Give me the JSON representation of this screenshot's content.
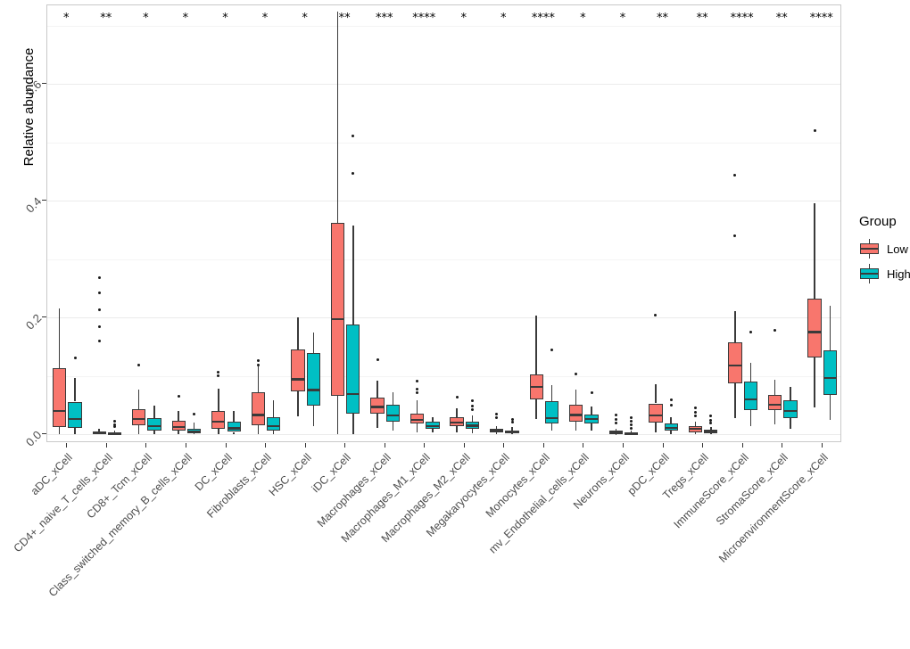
{
  "chart_data": {
    "type": "box",
    "title": "",
    "xlabel": "",
    "ylabel": "Relative abundance",
    "ylim": [
      -0.015,
      0.735
    ],
    "yticks": [
      0.0,
      0.2,
      0.4,
      0.6
    ],
    "ytick_labels": [
      "0.0",
      "0.2",
      "0.4",
      "0.6"
    ],
    "grid": true,
    "legend": {
      "title": "Group",
      "position": "right",
      "entries": [
        {
          "label": "Low",
          "color": "#F8766D"
        },
        {
          "label": "High",
          "color": "#00BFC4"
        }
      ]
    },
    "categories": [
      "aDC_xCell",
      "CD4+_naive_T_cells_xCell",
      "CD8+_Tcm_xCell",
      "Class_switched_memory_B_cells_xCell",
      "DC_xCell",
      "Fibroblasts_xCell",
      "HSC_xCell",
      "iDC_xCell",
      "Macrophages_xCell",
      "Macrophages_M1_xCell",
      "Macrophages_M2_xCell",
      "Megakaryocytes_xCell",
      "Monocytes_xCell",
      "mv_Endothelial_cells_xCell",
      "Neurons_xCell",
      "pDC_xCell",
      "Tregs_xCell",
      "ImmuneScore_xCell",
      "StromaScore_xCell",
      "MicroenvironmentScore_xCell"
    ],
    "significance": [
      "*",
      "**",
      "*",
      "*",
      "*",
      "*",
      "*",
      "**",
      "***",
      "****",
      "*",
      "*",
      "****",
      "*",
      "*",
      "**",
      "**",
      "****",
      "**",
      "****"
    ],
    "series": [
      {
        "name": "Low",
        "color": "#F8766D",
        "boxes": [
          {
            "lower_whisker": 0.0,
            "q1": 0.012,
            "median": 0.04,
            "q3": 0.113,
            "upper_whisker": 0.215,
            "outliers": []
          },
          {
            "lower_whisker": 0.0,
            "q1": 0.0,
            "median": 0.002,
            "q3": 0.005,
            "upper_whisker": 0.01,
            "outliers": [
              0.268,
              0.243,
              0.213,
              0.185,
              0.16
            ]
          },
          {
            "lower_whisker": 0.0,
            "q1": 0.016,
            "median": 0.026,
            "q3": 0.043,
            "upper_whisker": 0.076,
            "outliers": [
              0.118
            ]
          },
          {
            "lower_whisker": 0.0,
            "q1": 0.007,
            "median": 0.013,
            "q3": 0.023,
            "upper_whisker": 0.04,
            "outliers": [
              0.065
            ]
          },
          {
            "lower_whisker": 0.0,
            "q1": 0.01,
            "median": 0.022,
            "q3": 0.04,
            "upper_whisker": 0.078,
            "outliers": [
              0.106,
              0.1
            ]
          },
          {
            "lower_whisker": 0.0,
            "q1": 0.016,
            "median": 0.033,
            "q3": 0.072,
            "upper_whisker": 0.117,
            "outliers": [
              0.126,
              0.118
            ]
          },
          {
            "lower_whisker": 0.03,
            "q1": 0.074,
            "median": 0.094,
            "q3": 0.146,
            "upper_whisker": 0.2,
            "outliers": []
          },
          {
            "lower_whisker": 0.0,
            "q1": 0.066,
            "median": 0.197,
            "q3": 0.362,
            "upper_whisker": 0.725,
            "outliers": []
          },
          {
            "lower_whisker": 0.011,
            "q1": 0.035,
            "median": 0.047,
            "q3": 0.063,
            "upper_whisker": 0.092,
            "outliers": [
              0.128
            ]
          },
          {
            "lower_whisker": 0.004,
            "q1": 0.018,
            "median": 0.025,
            "q3": 0.036,
            "upper_whisker": 0.059,
            "outliers": [
              0.091,
              0.078,
              0.071
            ]
          },
          {
            "lower_whisker": 0.003,
            "q1": 0.014,
            "median": 0.02,
            "q3": 0.029,
            "upper_whisker": 0.044,
            "outliers": [
              0.063
            ]
          },
          {
            "lower_whisker": 0.0,
            "q1": 0.003,
            "median": 0.006,
            "q3": 0.009,
            "upper_whisker": 0.014,
            "outliers": [
              0.034,
              0.028
            ]
          },
          {
            "lower_whisker": 0.026,
            "q1": 0.06,
            "median": 0.081,
            "q3": 0.102,
            "upper_whisker": 0.203,
            "outliers": []
          },
          {
            "lower_whisker": 0.007,
            "q1": 0.022,
            "median": 0.033,
            "q3": 0.051,
            "upper_whisker": 0.077,
            "outliers": [
              0.104
            ]
          },
          {
            "lower_whisker": 0.0,
            "q1": 0.001,
            "median": 0.003,
            "q3": 0.006,
            "upper_whisker": 0.01,
            "outliers": [
              0.033,
              0.026,
              0.02
            ]
          },
          {
            "lower_whisker": 0.004,
            "q1": 0.02,
            "median": 0.032,
            "q3": 0.053,
            "upper_whisker": 0.086,
            "outliers": [
              0.205
            ]
          },
          {
            "lower_whisker": 0.0,
            "q1": 0.004,
            "median": 0.009,
            "q3": 0.014,
            "upper_whisker": 0.021,
            "outliers": [
              0.046,
              0.038,
              0.032
            ]
          },
          {
            "lower_whisker": 0.027,
            "q1": 0.088,
            "median": 0.118,
            "q3": 0.157,
            "upper_whisker": 0.211,
            "outliers": [
              0.444,
              0.34
            ]
          },
          {
            "lower_whisker": 0.017,
            "q1": 0.041,
            "median": 0.051,
            "q3": 0.067,
            "upper_whisker": 0.094,
            "outliers": [
              0.179
            ]
          },
          {
            "lower_whisker": 0.046,
            "q1": 0.132,
            "median": 0.175,
            "q3": 0.233,
            "upper_whisker": 0.396,
            "outliers": [
              0.521
            ]
          }
        ]
      },
      {
        "name": "High",
        "color": "#00BFC4",
        "boxes": [
          {
            "lower_whisker": 0.0,
            "q1": 0.011,
            "median": 0.026,
            "q3": 0.056,
            "upper_whisker": 0.097,
            "outliers": [
              0.131
            ]
          },
          {
            "lower_whisker": 0.0,
            "q1": 0.0,
            "median": 0.001,
            "q3": 0.003,
            "upper_whisker": 0.006,
            "outliers": [
              0.022,
              0.017,
              0.013
            ]
          },
          {
            "lower_whisker": 0.0,
            "q1": 0.006,
            "median": 0.014,
            "q3": 0.028,
            "upper_whisker": 0.049,
            "outliers": []
          },
          {
            "lower_whisker": 0.0,
            "q1": 0.002,
            "median": 0.005,
            "q3": 0.01,
            "upper_whisker": 0.02,
            "outliers": [
              0.034
            ]
          },
          {
            "lower_whisker": 0.0,
            "q1": 0.004,
            "median": 0.01,
            "q3": 0.021,
            "upper_whisker": 0.04,
            "outliers": []
          },
          {
            "lower_whisker": 0.0,
            "q1": 0.006,
            "median": 0.014,
            "q3": 0.03,
            "upper_whisker": 0.059,
            "outliers": []
          },
          {
            "lower_whisker": 0.014,
            "q1": 0.049,
            "median": 0.076,
            "q3": 0.14,
            "upper_whisker": 0.174,
            "outliers": []
          },
          {
            "lower_whisker": 0.0,
            "q1": 0.035,
            "median": 0.069,
            "q3": 0.188,
            "upper_whisker": 0.358,
            "outliers": [
              0.512,
              0.447
            ]
          },
          {
            "lower_whisker": 0.007,
            "q1": 0.021,
            "median": 0.032,
            "q3": 0.051,
            "upper_whisker": 0.072,
            "outliers": []
          },
          {
            "lower_whisker": 0.003,
            "q1": 0.01,
            "median": 0.014,
            "q3": 0.021,
            "upper_whisker": 0.029,
            "outliers": []
          },
          {
            "lower_whisker": 0.002,
            "q1": 0.01,
            "median": 0.015,
            "q3": 0.022,
            "upper_whisker": 0.032,
            "outliers": [
              0.058,
              0.049,
              0.043
            ]
          },
          {
            "lower_whisker": 0.0,
            "q1": 0.002,
            "median": 0.004,
            "q3": 0.007,
            "upper_whisker": 0.012,
            "outliers": [
              0.026,
              0.021
            ]
          },
          {
            "lower_whisker": 0.007,
            "q1": 0.018,
            "median": 0.028,
            "q3": 0.057,
            "upper_whisker": 0.085,
            "outliers": [
              0.144
            ]
          },
          {
            "lower_whisker": 0.006,
            "q1": 0.019,
            "median": 0.026,
            "q3": 0.034,
            "upper_whisker": 0.048,
            "outliers": [
              0.072
            ]
          },
          {
            "lower_whisker": 0.0,
            "q1": 0.0,
            "median": 0.001,
            "q3": 0.003,
            "upper_whisker": 0.007,
            "outliers": [
              0.029,
              0.022,
              0.016,
              0.011
            ]
          },
          {
            "lower_whisker": 0.0,
            "q1": 0.006,
            "median": 0.011,
            "q3": 0.019,
            "upper_whisker": 0.029,
            "outliers": [
              0.059,
              0.05
            ]
          },
          {
            "lower_whisker": 0.0,
            "q1": 0.002,
            "median": 0.004,
            "q3": 0.008,
            "upper_whisker": 0.013,
            "outliers": [
              0.031,
              0.024,
              0.019
            ]
          },
          {
            "lower_whisker": 0.014,
            "q1": 0.042,
            "median": 0.06,
            "q3": 0.091,
            "upper_whisker": 0.123,
            "outliers": [
              0.176
            ]
          },
          {
            "lower_whisker": 0.009,
            "q1": 0.028,
            "median": 0.04,
            "q3": 0.059,
            "upper_whisker": 0.082,
            "outliers": []
          },
          {
            "lower_whisker": 0.024,
            "q1": 0.068,
            "median": 0.097,
            "q3": 0.144,
            "upper_whisker": 0.221,
            "outliers": []
          }
        ]
      }
    ]
  }
}
